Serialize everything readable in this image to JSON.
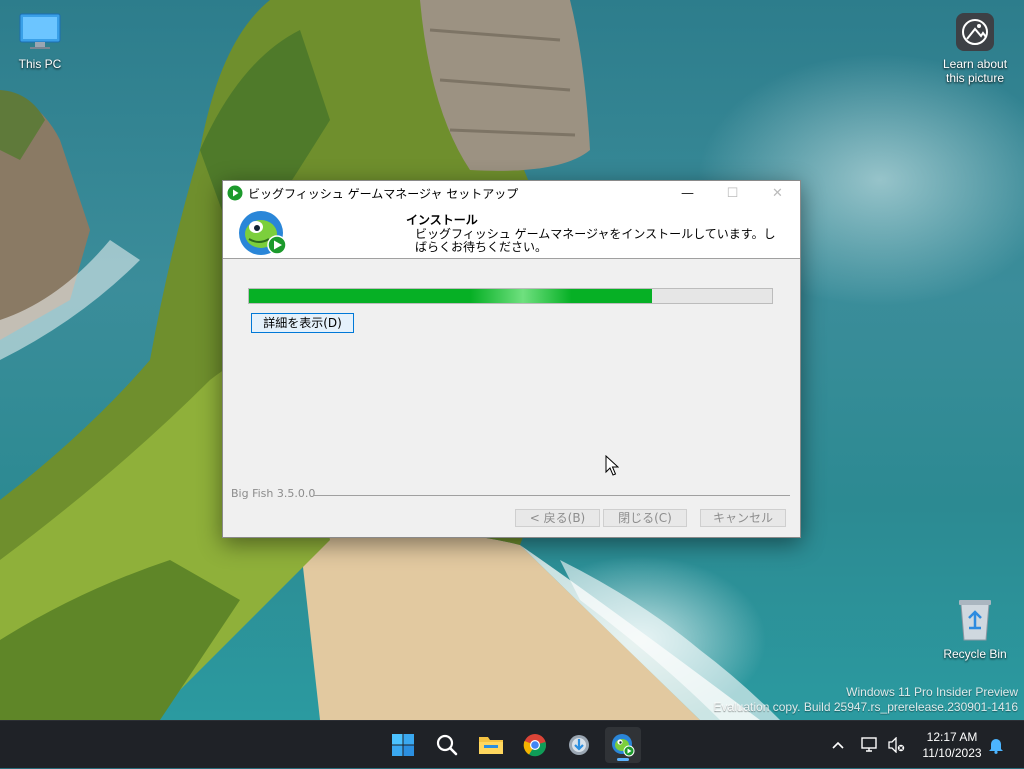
{
  "desktop": {
    "this_pc_label": "This PC",
    "learn_label_line1": "Learn about",
    "learn_label_line2": "this picture",
    "recycle_bin_label": "Recycle Bin",
    "watermark_line1": "Windows 11 Pro Insider Preview",
    "watermark_line2": "Evaluation copy. Build 25947.rs_prerelease.230901-1416"
  },
  "dialog": {
    "title": "ビッグフィッシュ ゲームマネージャ セットアップ",
    "minimize_glyph": "—",
    "maximize_glyph": "☐",
    "close_glyph": "✕",
    "header_title": "インストール",
    "header_sub": "ビッグフィッシュ ゲームマネージャをインストールしています。しばらくお待ちください。",
    "progress_fraction": 0.77,
    "details_button": "詳細を表示(D)",
    "version": "Big Fish 3.5.0.0",
    "back_button": "< 戻る(B)",
    "close_button": "閉じる(C)",
    "cancel_button": "キャンセル"
  },
  "taskbar": {
    "apps": [
      "start-icon",
      "search-icon",
      "file-explorer-icon",
      "chrome-icon",
      "setup-installer-icon",
      "big-fish-icon"
    ],
    "clock_time": "12:17 AM",
    "clock_date": "11/10/2023"
  },
  "colors": {
    "progress_green": "#06b025",
    "accent_blue": "#0078d7",
    "taskbar": "#1f2227"
  }
}
